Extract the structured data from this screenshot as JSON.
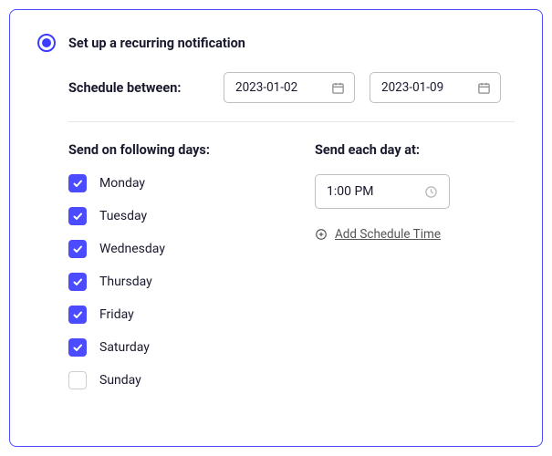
{
  "header": {
    "title": "Set up a recurring notification"
  },
  "schedule": {
    "label": "Schedule between:",
    "start": "2023-01-02",
    "end": "2023-01-09"
  },
  "days": {
    "heading": "Send on following days:",
    "items": [
      {
        "label": "Monday",
        "checked": true
      },
      {
        "label": "Tuesday",
        "checked": true
      },
      {
        "label": "Wednesday",
        "checked": true
      },
      {
        "label": "Thursday",
        "checked": true
      },
      {
        "label": "Friday",
        "checked": true
      },
      {
        "label": "Saturday",
        "checked": true
      },
      {
        "label": "Sunday",
        "checked": false
      }
    ]
  },
  "time": {
    "heading": "Send each day at:",
    "value": "1:00 PM",
    "add_label": "Add Schedule Time"
  }
}
